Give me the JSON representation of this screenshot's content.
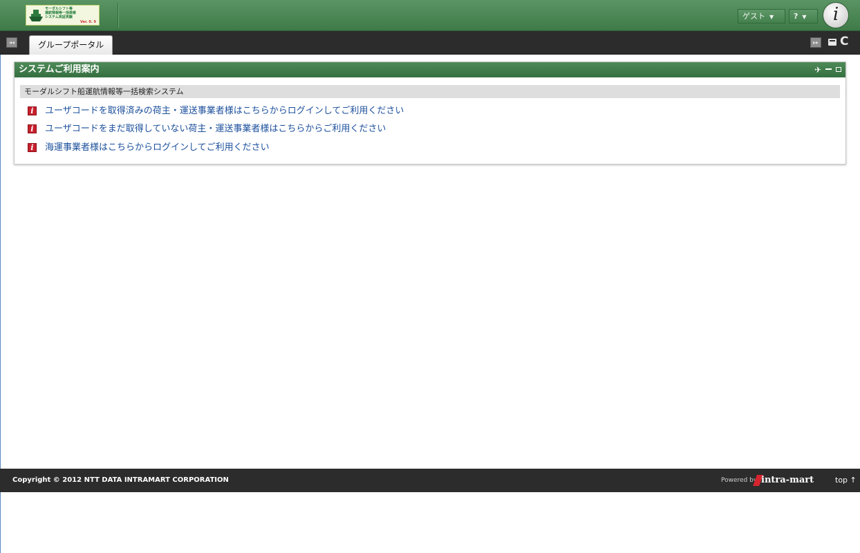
{
  "header": {
    "logo_lines": [
      "モーダルシフト等",
      "運航情報等一括検索",
      "システム実証実験"
    ],
    "logo_version": "Ver. 0. 9",
    "user_menu_label": "ゲスト",
    "help_label": "?"
  },
  "tabs": [
    {
      "label": "グループポータル"
    }
  ],
  "portlet": {
    "title": "システムご利用案内",
    "section_title": "モーダルシフト船運航情報等一括検索システム",
    "links": [
      {
        "label": "ユーザコードを取得済みの荷主・運送事業者様はこちらからログインしてご利用ください",
        "icon": "info-icon"
      },
      {
        "label": "ユーザコードをまだ取得していない荷主・運送事業者様はこちらからご利用ください",
        "icon": "info-icon"
      },
      {
        "label": "海運事業者様はこちらからログインしてご利用ください",
        "icon": "info-icon"
      }
    ]
  },
  "footer": {
    "copyright": "Copyright © 2012 NTT DATA INTRAMART CORPORATION",
    "powered_by": "Powered by",
    "brand": "intra-mart",
    "top_link": "top ↑"
  },
  "colors": {
    "header_green": "#4a8a55",
    "portlet_head": "#3f7a49",
    "dark_bar": "#2c2c2c",
    "link_blue": "#1b4f9c",
    "icon_red": "#c7202d"
  }
}
